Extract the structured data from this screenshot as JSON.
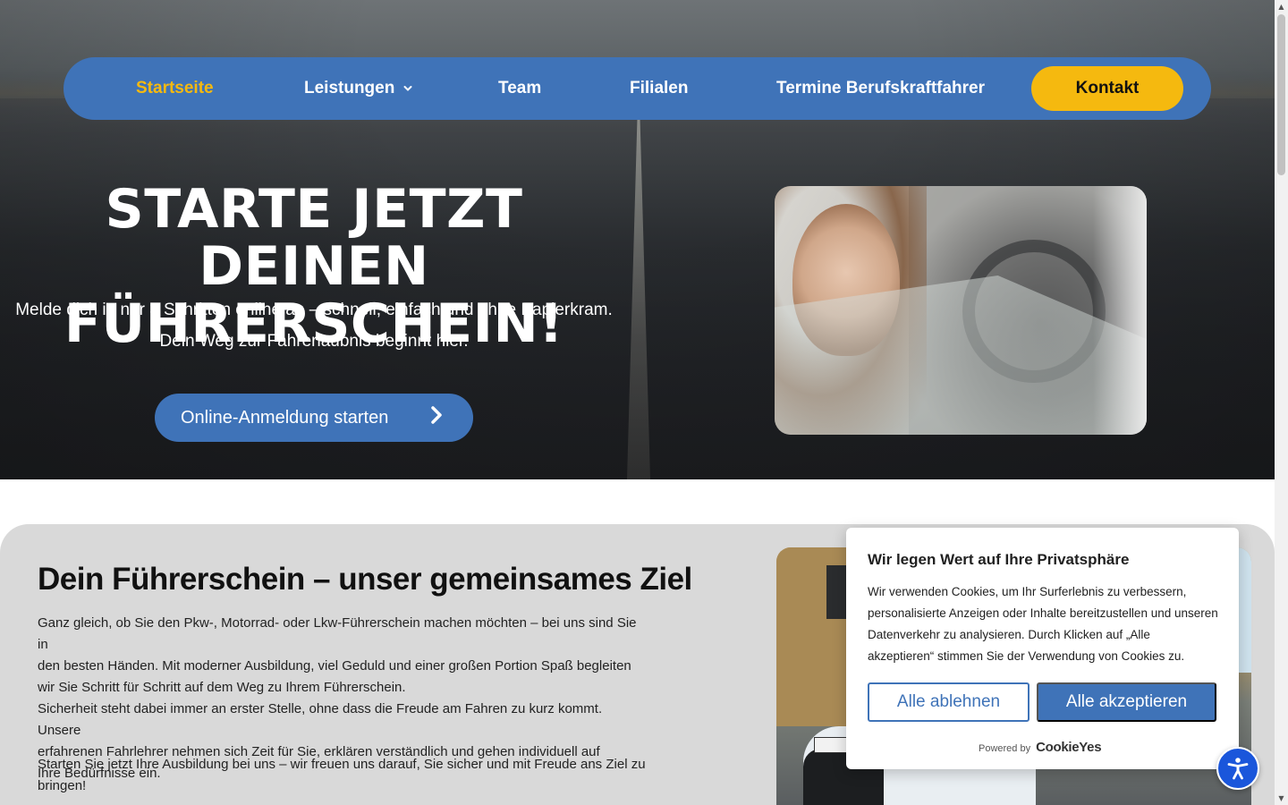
{
  "nav": {
    "items": [
      {
        "label": "Startseite",
        "active": true
      },
      {
        "label": "Leistungen",
        "dropdown": true
      },
      {
        "label": "Team"
      },
      {
        "label": "Filialen"
      },
      {
        "label": "Termine Berufskraftfahrer"
      }
    ],
    "contact_label": "Kontakt"
  },
  "hero": {
    "title_line1": "STARTE JETZT DEINEN",
    "title_line2": "FÜHRERSCHEIN!",
    "subtitle1": "Melde dich in nur 3 Schritten online an – schnell, einfach und ohne Papierkram.",
    "subtitle2": "Dein Weg zur Fahrerlaubnis beginnt hier.",
    "cta_label": "Online-Anmeldung starten"
  },
  "section2": {
    "title": "Dein Führerschein – unser gemeinsames Ziel",
    "paragraph1_line1": "Ganz gleich, ob Sie den Pkw-, Motorrad- oder Lkw-Führerschein machen möchten – bei uns sind Sie in",
    "paragraph1_line2": "den besten Händen. Mit moderner Ausbildung, viel Geduld und einer großen Portion Spaß begleiten",
    "paragraph1_line3": "wir Sie Schritt für Schritt auf dem Weg zu Ihrem Führerschein.",
    "paragraph1_line4": "Sicherheit steht dabei immer an erster Stelle, ohne dass die Freude am Fahren zu kurz kommt. Unsere",
    "paragraph1_line5": "erfahrenen Fahrlehrer nehmen sich Zeit für Sie, erklären verständlich und gehen individuell auf",
    "paragraph1_line6": "Ihre Bedürfnisse ein.",
    "paragraph2_line1": "Starten Sie jetzt Ihre Ausbildung bei uns – wir freuen uns darauf, Sie sicher und mit Freude ans Ziel zu",
    "paragraph2_line2": "bringen!"
  },
  "cookie": {
    "title": "Wir legen Wert auf Ihre Privatsphäre",
    "text": "Wir verwenden Cookies, um Ihr Surferlebnis zu verbessern, personalisierte Anzeigen oder Inhalte bereitzustellen und unseren Datenverkehr zu analysieren. Durch Klicken auf „Alle akzeptieren“ stimmen Sie der Verwendung von Cookies zu.",
    "reject_label": "Alle ablehnen",
    "accept_label": "Alle akzeptieren",
    "powered_label": "Powered by",
    "powered_brand": "CookieYes"
  },
  "icons": {
    "nav_dropdown": "chevron-down-icon",
    "cta": "chevron-right-icon",
    "accessibility": "accessibility-person-icon"
  },
  "colors": {
    "brand_blue": "#3f73b8",
    "accent_yellow": "#f5b90f",
    "section_gray": "#d9d9d9",
    "a11y_blue": "#1a56db"
  }
}
